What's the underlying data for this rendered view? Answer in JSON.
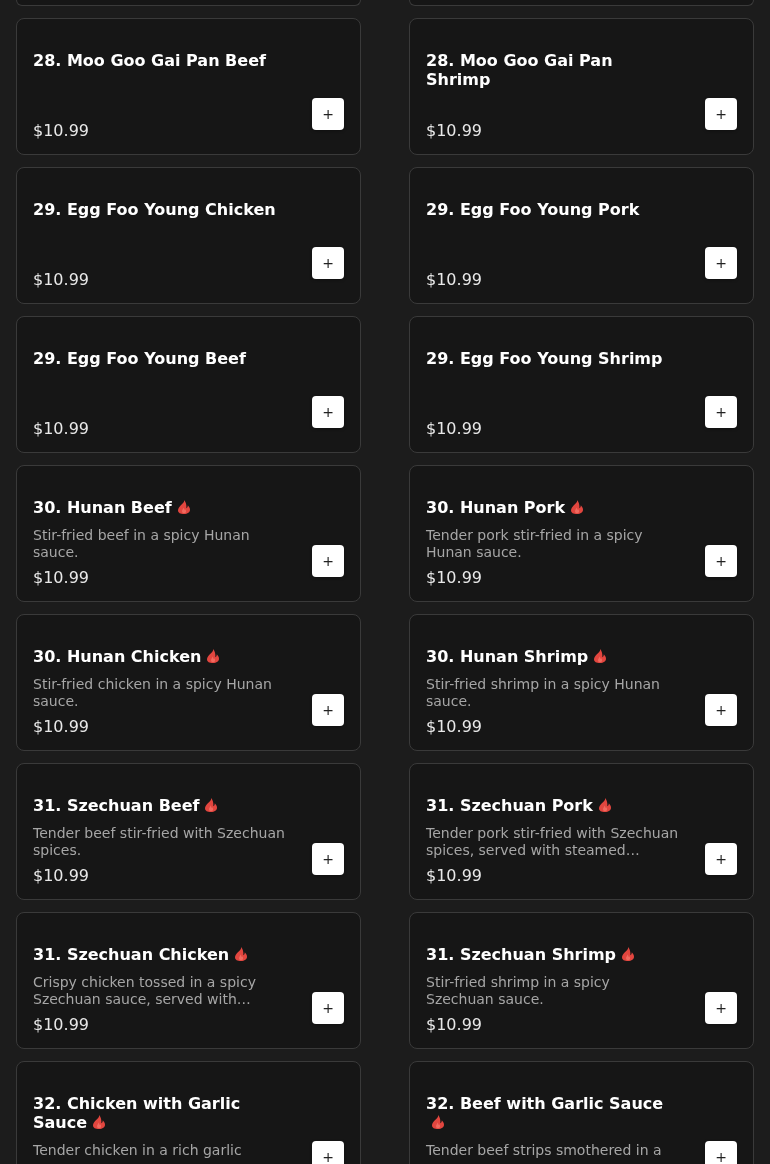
{
  "menu": {
    "partial_row_above": true,
    "items": [
      {
        "name": "28. Moo Goo Gai Pan Beef",
        "spicy": false,
        "price": "$10.99",
        "button": "+"
      },
      {
        "name": "28. Moo Goo Gai Pan Shrimp",
        "spicy": false,
        "price": "$10.99",
        "button": "+"
      },
      {
        "name": "29. Egg Foo Young Chicken",
        "spicy": false,
        "price": "$10.99",
        "button": "+"
      },
      {
        "name": "29. Egg Foo Young Pork",
        "spicy": false,
        "price": "$10.99",
        "button": "+"
      },
      {
        "name": "29. Egg Foo Young Beef",
        "spicy": false,
        "price": "$10.99",
        "button": "+"
      },
      {
        "name": "29. Egg Foo Young Shrimp",
        "spicy": false,
        "price": "$10.99",
        "button": "+"
      },
      {
        "name": "30. Hunan Beef",
        "spicy": true,
        "description": "Stir-fried beef in a spicy Hunan sauce.",
        "price": "$10.99",
        "button": "+"
      },
      {
        "name": "30. Hunan Pork",
        "spicy": true,
        "description": "Tender pork stir-fried in a spicy Hunan sauce.",
        "price": "$10.99",
        "button": "+"
      },
      {
        "name": "30. Hunan Chicken",
        "spicy": true,
        "description": "Stir-fried chicken in a spicy Hunan sauce.",
        "price": "$10.99",
        "button": "+"
      },
      {
        "name": "30. Hunan Shrimp",
        "spicy": true,
        "description": "Stir-fried shrimp in a spicy Hunan sauce.",
        "price": "$10.99",
        "button": "+"
      },
      {
        "name": "31. Szechuan Beef",
        "spicy": true,
        "description": "Tender beef stir-fried with Szechuan spices.",
        "price": "$10.99",
        "button": "+"
      },
      {
        "name": "31. Szechuan Pork",
        "spicy": true,
        "description": "Tender pork stir-fried with Szechuan spices, served with steamed…",
        "price": "$10.99",
        "button": "+"
      },
      {
        "name": "31. Szechuan Chicken",
        "spicy": true,
        "description": "Crispy chicken tossed in a spicy Szechuan sauce, served with…",
        "price": "$10.99",
        "button": "+"
      },
      {
        "name": "31. Szechuan Shrimp",
        "spicy": true,
        "description": "Stir-fried shrimp in a spicy Szechuan sauce.",
        "price": "$10.99",
        "button": "+"
      },
      {
        "name": "32. Chicken with Garlic Sauce",
        "spicy": true,
        "description": "Tender chicken in a rich garlic",
        "button": "+"
      },
      {
        "name": "32. Beef with Garlic Sauce",
        "spicy": true,
        "description": "Tender beef strips smothered in a",
        "button": "+"
      }
    ]
  }
}
